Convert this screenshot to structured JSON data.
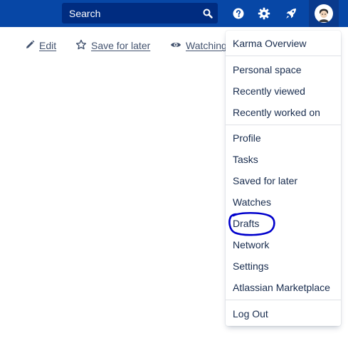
{
  "topbar": {
    "search": {
      "placeholder": "Search"
    },
    "icons": [
      "search-icon",
      "help-icon",
      "gear-icon",
      "notification-icon",
      "avatar"
    ]
  },
  "toolbar": {
    "edit_label": "Edit",
    "save_label": "Save for later",
    "watch_label": "Watching"
  },
  "menu": {
    "items": [
      {
        "label": "Karma Overview"
      },
      {
        "label": "Personal space"
      },
      {
        "label": "Recently viewed"
      },
      {
        "label": "Recently worked on"
      },
      {
        "label": "Profile"
      },
      {
        "label": "Tasks"
      },
      {
        "label": "Saved for later"
      },
      {
        "label": "Watches"
      },
      {
        "label": "Drafts"
      },
      {
        "label": "Network"
      },
      {
        "label": "Settings"
      },
      {
        "label": "Atlassian Marketplace"
      },
      {
        "label": "Log Out"
      }
    ]
  },
  "colors": {
    "topbar": "#0747a6",
    "search_bg": "#002c80",
    "annotation": "#0000cc"
  }
}
